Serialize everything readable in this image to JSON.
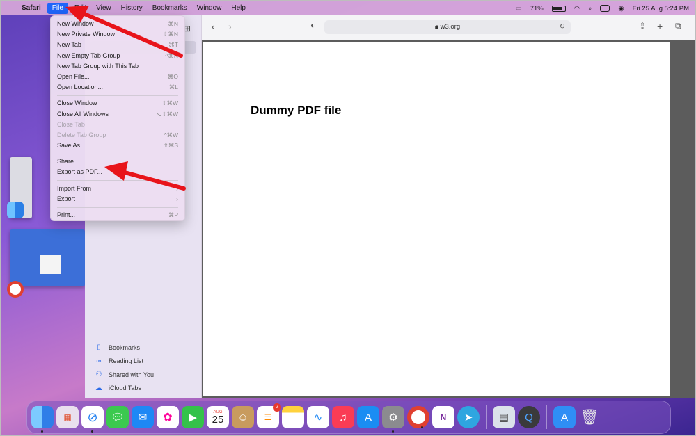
{
  "menubar": {
    "items": [
      "Safari",
      "File",
      "Edit",
      "View",
      "History",
      "Bookmarks",
      "Window",
      "Help"
    ],
    "battery": "71%",
    "datetime": "Fri 25 Aug  5:24 PM"
  },
  "file_menu": {
    "items": [
      {
        "label": "New Window",
        "shortcut": "⌘N"
      },
      {
        "label": "New Private Window",
        "shortcut": "⇧⌘N"
      },
      {
        "label": "New Tab",
        "shortcut": "⌘T"
      },
      {
        "label": "New Empty Tab Group",
        "shortcut": "^⌘N"
      },
      {
        "label": "New Tab Group with This Tab",
        "shortcut": ""
      },
      {
        "label": "Open File...",
        "shortcut": "⌘O"
      },
      {
        "label": "Open Location...",
        "shortcut": "⌘L"
      },
      {
        "label": "Close Window",
        "shortcut": "⇧⌘W"
      },
      {
        "label": "Close All Windows",
        "shortcut": "⌥⇧⌘W"
      },
      {
        "label": "Close Tab",
        "shortcut": ""
      },
      {
        "label": "Delete Tab Group",
        "shortcut": "^⌘W"
      },
      {
        "label": "Save As...",
        "shortcut": "⇧⌘S"
      },
      {
        "label": "Share...",
        "shortcut": ""
      },
      {
        "label": "Export as PDF...",
        "shortcut": ""
      },
      {
        "label": "Import From",
        "shortcut": "›"
      },
      {
        "label": "Export",
        "shortcut": "›"
      },
      {
        "label": "Print...",
        "shortcut": "⌘P"
      }
    ]
  },
  "toolbar": {
    "address": "w3.org"
  },
  "page": {
    "title": "Dummy PDF file"
  },
  "sidebar": {
    "items": [
      "Bookmarks",
      "Reading List",
      "Shared with You",
      "iCloud Tabs"
    ]
  },
  "dock": {
    "calendar_month": "AUG",
    "calendar_day": "25",
    "reminders_badge": "2"
  }
}
